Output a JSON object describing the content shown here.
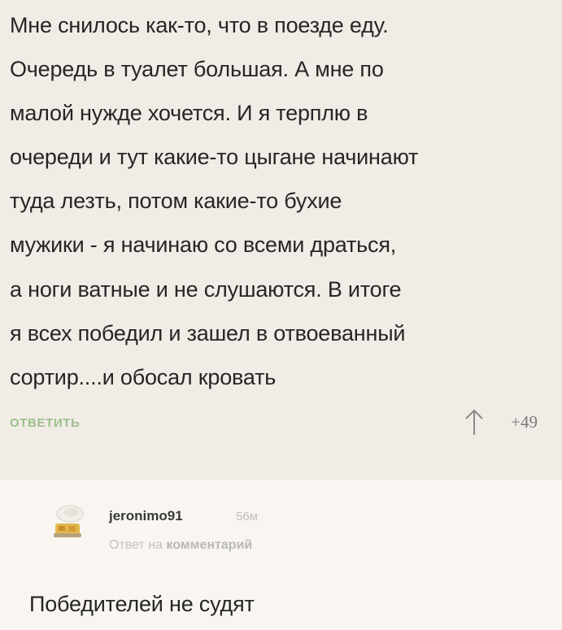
{
  "comment": {
    "lines": [
      "Мне снилось как-то, что в поезде еду.",
      "Очередь в туалет большая. А мне по",
      "малой нужде хочется.  И я терплю в",
      "очереди и тут какие-то цыгане начинают",
      "туда лезть, потом какие-то бухие",
      "мужики - я начинаю со всеми драться,",
      "а ноги ватные и не слушаются. В итоге",
      "я всех победил и зашел в отвоеванный",
      "сортир....и обосал кровать"
    ],
    "reply_label": "ОТВЕТИТЬ",
    "score": "+49"
  },
  "reply": {
    "username": "jeronimo91",
    "time": "56м",
    "meta_prefix": "Ответ на",
    "meta_link": "комментарий",
    "text": "Победителей не судят"
  },
  "colors": {
    "reply_link": "#9cbf8d",
    "background_top": "#f1ece5",
    "background_reply": "#f9f6f1"
  },
  "icons": {
    "upvote": "arrow-up-icon",
    "avatar": "food-avatar-icon"
  }
}
